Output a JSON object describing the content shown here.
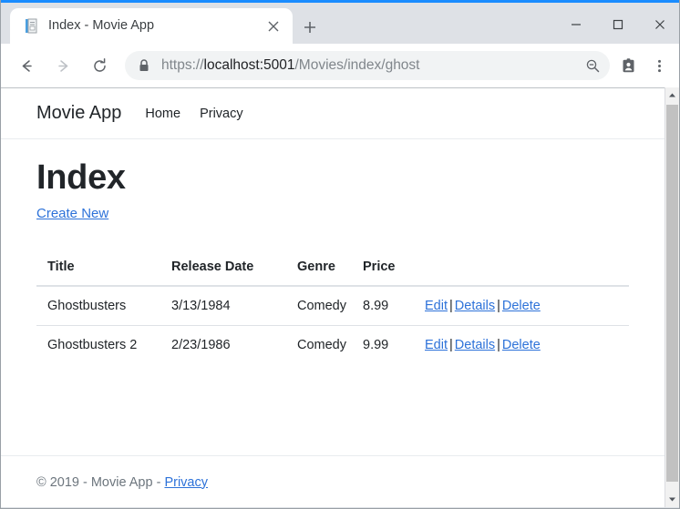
{
  "browser": {
    "tab": {
      "title": "Index - Movie App",
      "favicon_name": "document-favicon",
      "close_label": "×"
    },
    "new_tab_label": "+",
    "window_controls": {
      "minimize": "—",
      "maximize": "□",
      "close": "×"
    },
    "toolbar": {
      "back_name": "back-arrow-icon",
      "forward_name": "forward-arrow-icon",
      "reload_name": "reload-icon",
      "lock_name": "lock-icon",
      "url_scheme": "https://",
      "url_host": "localhost:5001",
      "url_path": "/Movies/index/ghost",
      "zoom_name": "zoom-out-icon",
      "profile_name": "profile-badge-icon",
      "menu_name": "three-dot-menu-icon"
    },
    "accent_color": "#1a8cff",
    "chrome_color": "#dee1e6"
  },
  "site": {
    "navbar": {
      "brand": "Movie App",
      "links": [
        {
          "label": "Home"
        },
        {
          "label": "Privacy"
        }
      ]
    },
    "main": {
      "title": "Index",
      "create_new_label": "Create New",
      "table": {
        "headers": [
          "Title",
          "Release Date",
          "Genre",
          "Price"
        ],
        "actions_header": "",
        "rows": [
          {
            "title": "Ghostbusters",
            "release_date": "3/13/1984",
            "genre": "Comedy",
            "price": "8.99",
            "actions": {
              "edit": "Edit",
              "details": "Details",
              "delete": "Delete"
            }
          },
          {
            "title": "Ghostbusters 2",
            "release_date": "2/23/1986",
            "genre": "Comedy",
            "price": "9.99",
            "actions": {
              "edit": "Edit",
              "details": "Details",
              "delete": "Delete"
            }
          }
        ],
        "action_separator": "|"
      }
    },
    "footer": {
      "copyright": "© 2019 - Movie App - ",
      "privacy_label": "Privacy"
    },
    "link_color": "#2d72d9"
  }
}
